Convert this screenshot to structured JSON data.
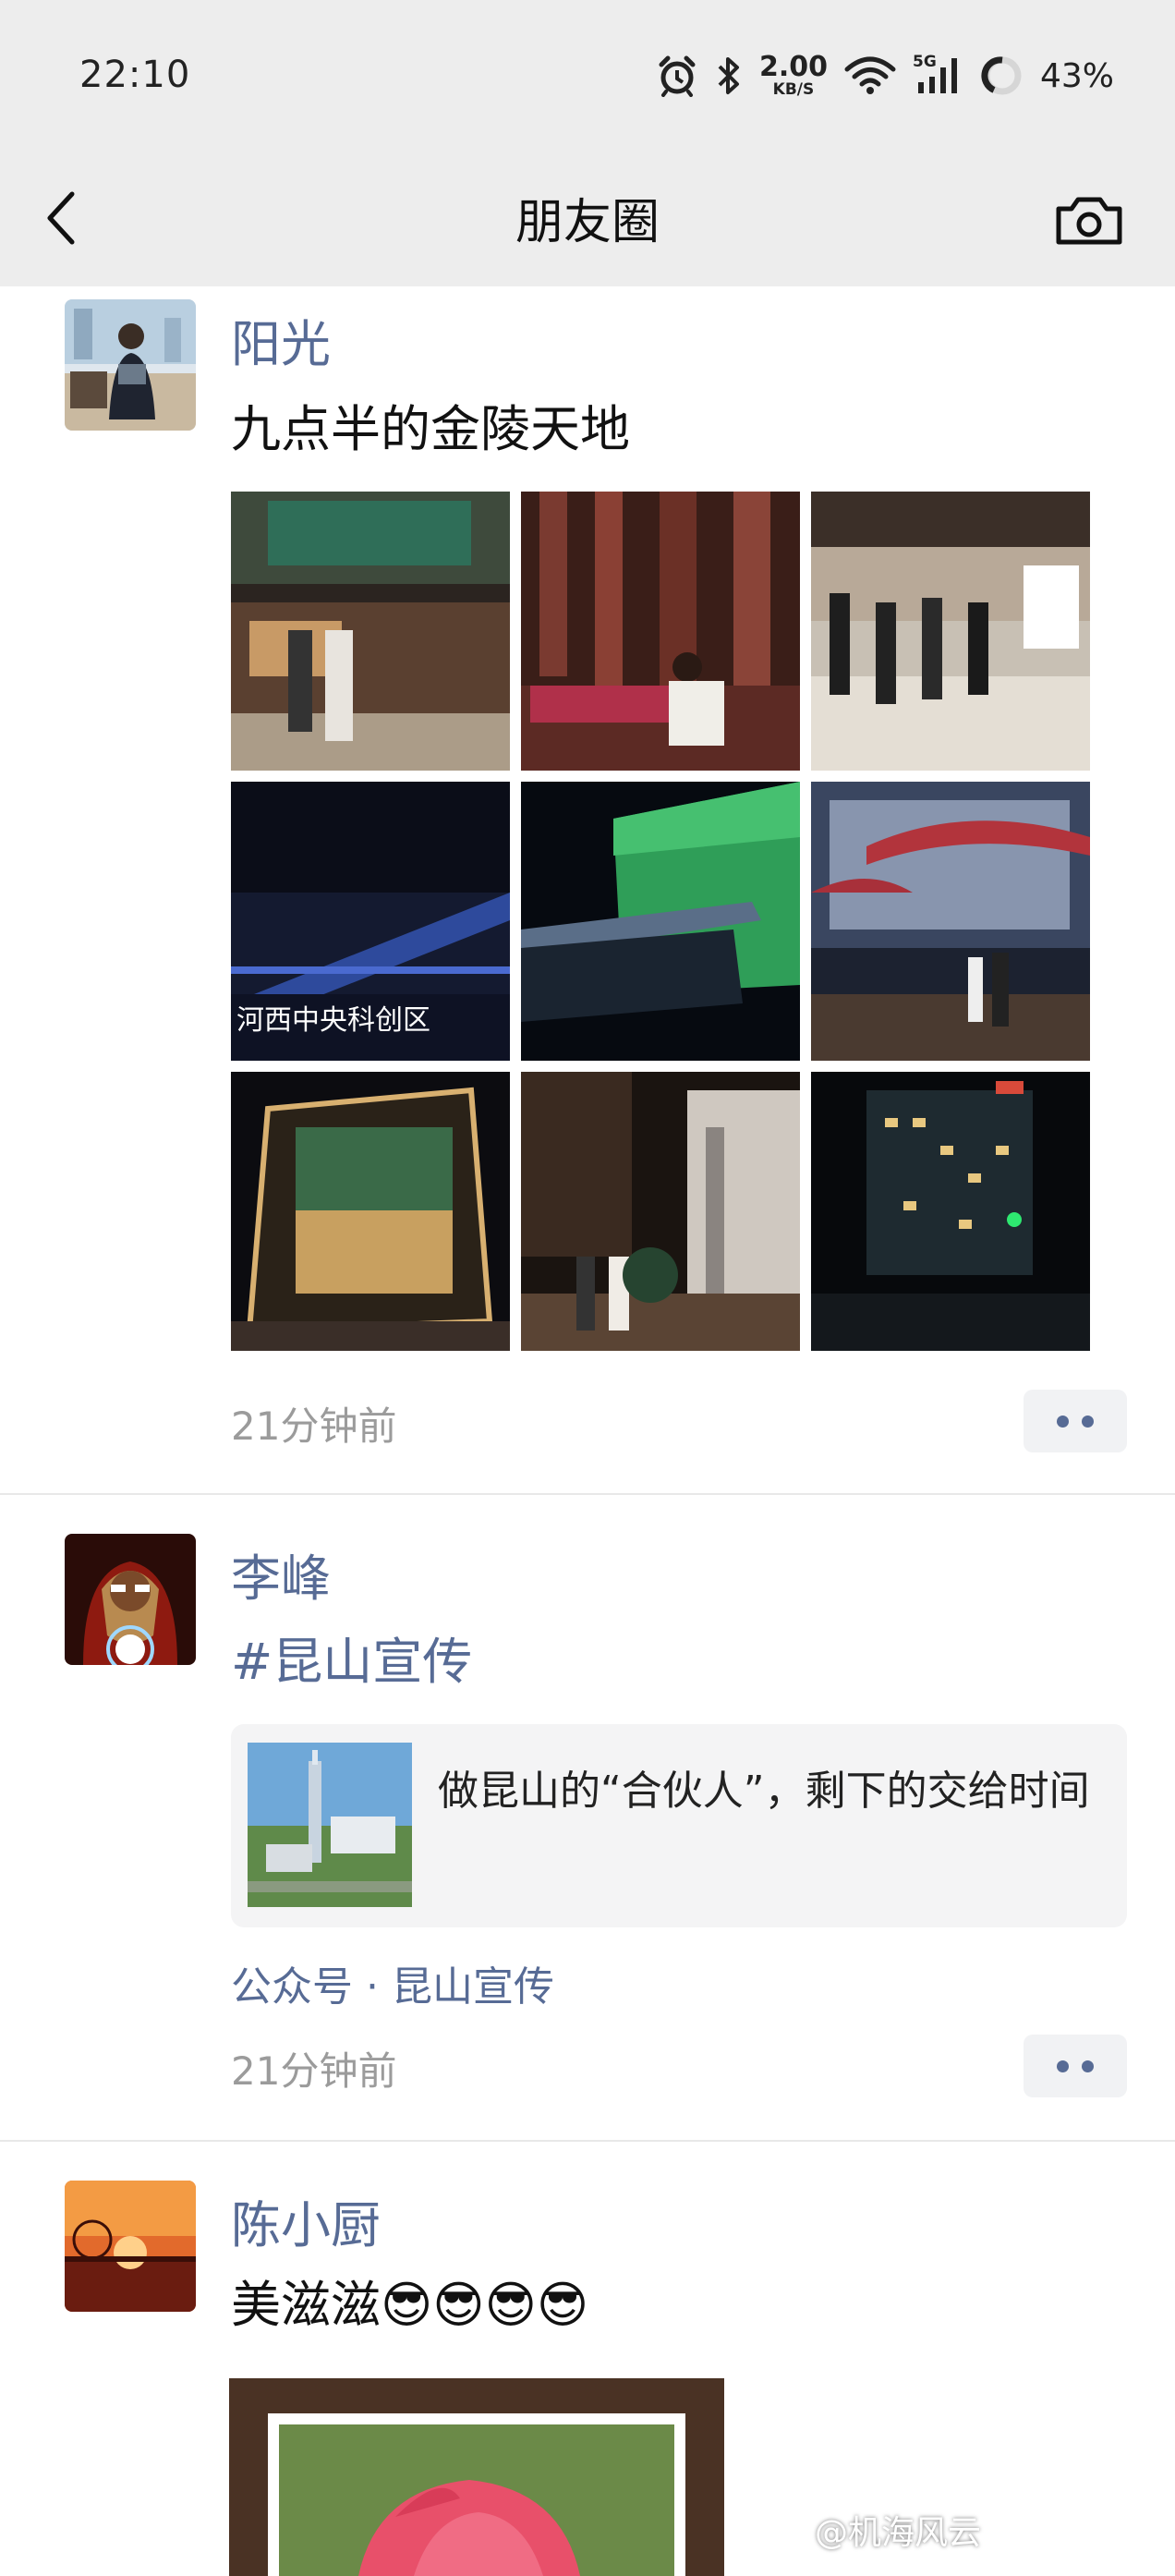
{
  "status_bar": {
    "time": "22:10",
    "net_speed_value": "2.00",
    "net_speed_unit": "KB/S",
    "network_type": "5G",
    "battery_percent": "43%"
  },
  "nav": {
    "title": "朋友圈"
  },
  "posts": [
    {
      "username": "阳光",
      "text": "九点半的金陵天地",
      "photo_count": 9,
      "time_ago": "21分钟前"
    },
    {
      "username": "李峰",
      "hashtag": "#昆山宣传",
      "link_title": "做昆山的“合伙人”，剩下的交给时间",
      "source": "公众号 · 昆山宣传",
      "time_ago": "21分钟前"
    },
    {
      "username": "陈小厨",
      "text": "美滋滋😎😎😎😎"
    }
  ],
  "watermark": "@机海风云",
  "colors": {
    "link_blue": "#576b95",
    "bar_gray": "#ededed",
    "timestamp_gray": "#9b9b9b"
  }
}
